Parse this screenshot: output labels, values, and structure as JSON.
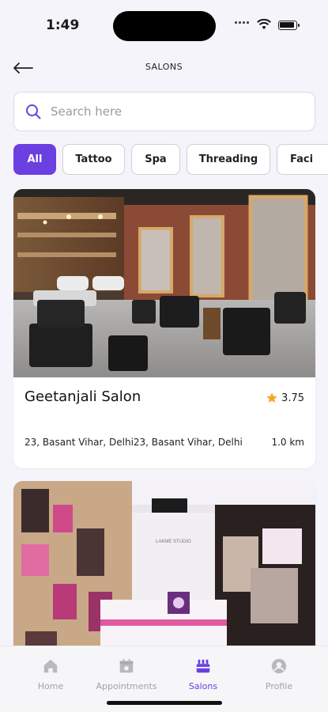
{
  "status": {
    "time": "1:49"
  },
  "header": {
    "title": "SALONS"
  },
  "search": {
    "placeholder": "Search here"
  },
  "categories": [
    "All",
    "Tattoo",
    "Spa",
    "Threading",
    "Faci"
  ],
  "salons": [
    {
      "name": "Geetanjali Salon",
      "rating": "3.75",
      "address": "23, Basant Vihar, Delhi23, Basant Vihar, Delhi",
      "distance": "1.0 km"
    },
    {
      "storefront_sign": "LAKME STUDIO"
    }
  ],
  "tabs": [
    {
      "label": "Home",
      "icon": "home-icon"
    },
    {
      "label": "Appointments",
      "icon": "calendar-icon"
    },
    {
      "label": "Salons",
      "icon": "salon-icon"
    },
    {
      "label": "Profile",
      "icon": "profile-icon"
    }
  ],
  "colors": {
    "accent": "#6c3fe0",
    "star": "#f5a623"
  }
}
